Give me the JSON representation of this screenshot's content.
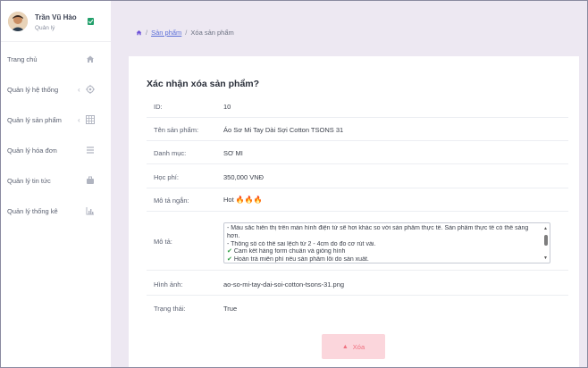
{
  "user": {
    "name": "Trần Vũ Hào",
    "role": "Quản lý"
  },
  "sidebar": {
    "items": [
      {
        "label": "Trang chủ",
        "icon": "home-icon",
        "caret": false
      },
      {
        "label": "Quản lý hệ thống",
        "icon": "target-icon",
        "caret": true
      },
      {
        "label": "Quản lý sản phẩm",
        "icon": "grid-icon",
        "caret": true
      },
      {
        "label": "Quản lý hóa đơn",
        "icon": "list-icon",
        "caret": false
      },
      {
        "label": "Quản lý tin tức",
        "icon": "briefcase-icon",
        "caret": false
      },
      {
        "label": "Quản lý thống kê",
        "icon": "bar-chart-icon",
        "caret": false
      }
    ]
  },
  "breadcrumb": {
    "sep": "/",
    "link": "Sản phẩm",
    "current": "Xóa sản phẩm"
  },
  "card": {
    "title": "Xác nhận xóa sản phẩm?",
    "fields": {
      "id": {
        "label": "ID:",
        "value": "10"
      },
      "name": {
        "label": "Tên sản phẩm:",
        "value": "Áo Sơ Mi Tay Dài Sợi Cotton TSONS 31"
      },
      "category": {
        "label": "Danh mục:",
        "value": "SƠ MI"
      },
      "price": {
        "label": "Học phí:",
        "value": "350,000 VNĐ"
      },
      "short_desc": {
        "label": "Mô tả ngắn:",
        "value": "Hot",
        "emoji": "🔥🔥🔥"
      },
      "desc": {
        "label": "Mô tả:",
        "lines": [
          "- Màu sắc hiển thị trên màn hình điện tử sẽ hơi khác so với sản phẩm thực tế. Sản phẩm thực tế có thể sáng",
          "hơn.",
          "- Thông số có thể sai lệch từ 2 - 4cm do đo cơ rút vải.",
          "Cam kết hàng form chuẩn và giống hình",
          "Hoàn trả miễn phí nếu sản phẩm lỗi do sản xuất."
        ]
      },
      "image": {
        "label": "Hình ảnh:",
        "value": "ao-so-mi-tay-dai-soi-cotton-tsons-31.png"
      },
      "status": {
        "label": "Trạng thái:",
        "value": "True"
      }
    },
    "delete_label": "Xóa"
  },
  "colors": {
    "accent": "#6b4fd8",
    "danger_bg": "#fbd6dc",
    "danger_fg": "#f0707f",
    "check": "#22a06b"
  }
}
